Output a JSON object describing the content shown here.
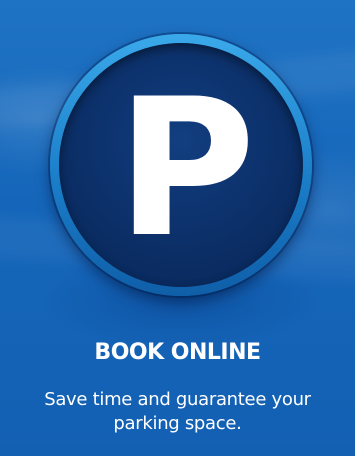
{
  "badge": {
    "letter": "P",
    "icon": "parking-icon"
  },
  "title": "BOOK ONLINE",
  "subtitle": "Save time and guarantee your parking space.",
  "colors": {
    "background": "#1466b8",
    "ring": "#2b95d9",
    "badge_fill": "#0b2e66",
    "text": "#ffffff"
  }
}
